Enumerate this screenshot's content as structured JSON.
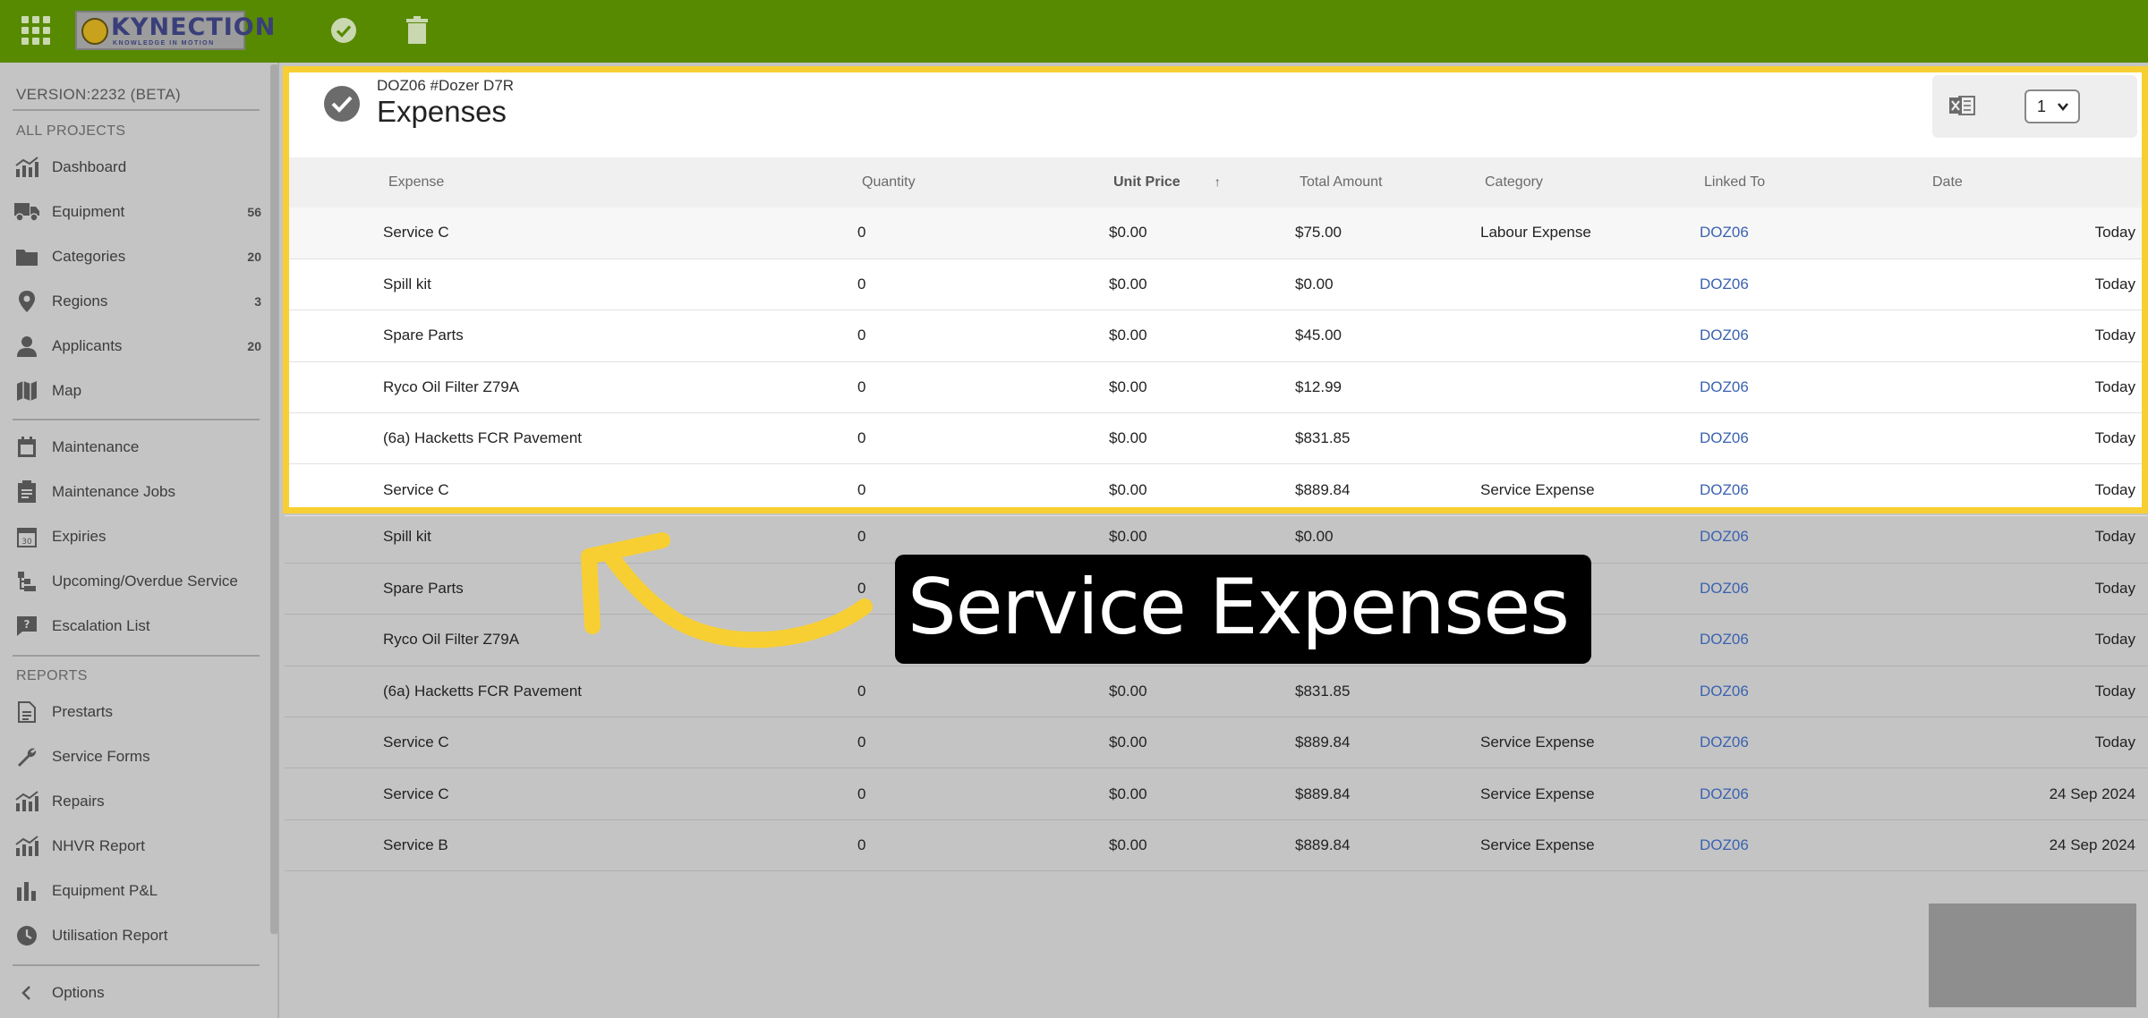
{
  "topbar": {
    "logo_text": "KYNECTION",
    "logo_tagline": "KNOWLEDGE IN MOTION"
  },
  "sidebar": {
    "version": "VERSION:2232 (BETA)",
    "section_projects": "ALL PROJECTS",
    "section_reports": "REPORTS",
    "items": [
      {
        "label": "Dashboard",
        "count": "",
        "icon": "chart-icon"
      },
      {
        "label": "Equipment",
        "count": "56",
        "icon": "truck-icon"
      },
      {
        "label": "Categories",
        "count": "20",
        "icon": "folder-icon"
      },
      {
        "label": "Regions",
        "count": "3",
        "icon": "pin-icon"
      },
      {
        "label": "Applicants",
        "count": "20",
        "icon": "person-icon"
      },
      {
        "label": "Map",
        "count": "",
        "icon": "map-icon"
      },
      {
        "label": "Maintenance",
        "count": "",
        "icon": "calendar-icon"
      },
      {
        "label": "Maintenance Jobs",
        "count": "",
        "icon": "clipboard-icon"
      },
      {
        "label": "Expiries",
        "count": "",
        "icon": "calendar-30-icon"
      },
      {
        "label": "Upcoming/Overdue Service",
        "count": "",
        "icon": "tree-icon"
      },
      {
        "label": "Escalation List",
        "count": "",
        "icon": "question-icon"
      },
      {
        "label": "Prestarts",
        "count": "",
        "icon": "document-icon"
      },
      {
        "label": "Service Forms",
        "count": "",
        "icon": "wrench-icon"
      },
      {
        "label": "Repairs",
        "count": "",
        "icon": "chart-icon"
      },
      {
        "label": "NHVR Report",
        "count": "",
        "icon": "chart-icon"
      },
      {
        "label": "Equipment P&L",
        "count": "",
        "icon": "bars-icon"
      },
      {
        "label": "Utilisation Report",
        "count": "",
        "icon": "clock-icon"
      }
    ],
    "options_label": "Options"
  },
  "header": {
    "equipment_id": "DOZ06 #Dozer D7R",
    "title": "Expenses",
    "page_select_value": "1"
  },
  "table": {
    "columns": [
      "Expense",
      "Quantity",
      "Unit Price",
      "Total Amount",
      "Category",
      "Linked To",
      "Date"
    ],
    "sort_indicator": "↑",
    "rows": [
      {
        "expense": "Service C",
        "qty": "0",
        "unit": "$0.00",
        "total": "$75.00",
        "category": "Labour Expense",
        "linked": "DOZ06",
        "date": "Today"
      },
      {
        "expense": "Spill kit",
        "qty": "0",
        "unit": "$0.00",
        "total": "$0.00",
        "category": "",
        "linked": "DOZ06",
        "date": "Today"
      },
      {
        "expense": "Spare Parts",
        "qty": "0",
        "unit": "$0.00",
        "total": "$45.00",
        "category": "",
        "linked": "DOZ06",
        "date": "Today"
      },
      {
        "expense": "Ryco Oil Filter Z79A",
        "qty": "0",
        "unit": "$0.00",
        "total": "$12.99",
        "category": "",
        "linked": "DOZ06",
        "date": "Today"
      },
      {
        "expense": "(6a) Hacketts FCR Pavement",
        "qty": "0",
        "unit": "$0.00",
        "total": "$831.85",
        "category": "",
        "linked": "DOZ06",
        "date": "Today"
      },
      {
        "expense": "Service C",
        "qty": "0",
        "unit": "$0.00",
        "total": "$889.84",
        "category": "Service Expense",
        "linked": "DOZ06",
        "date": "Today"
      },
      {
        "expense": "Spill kit",
        "qty": "0",
        "unit": "$0.00",
        "total": "$0.00",
        "category": "",
        "linked": "DOZ06",
        "date": "Today"
      },
      {
        "expense": "Spare Parts",
        "qty": "0",
        "unit": "",
        "total": "",
        "category": "",
        "linked": "DOZ06",
        "date": "Today"
      },
      {
        "expense": "Ryco Oil Filter Z79A",
        "qty": "",
        "unit": "",
        "total": "",
        "category": "",
        "linked": "DOZ06",
        "date": "Today"
      },
      {
        "expense": "(6a) Hacketts FCR Pavement",
        "qty": "0",
        "unit": "$0.00",
        "total": "$831.85",
        "category": "",
        "linked": "DOZ06",
        "date": "Today"
      },
      {
        "expense": "Service C",
        "qty": "0",
        "unit": "$0.00",
        "total": "$889.84",
        "category": "Service Expense",
        "linked": "DOZ06",
        "date": "Today"
      },
      {
        "expense": "Service C",
        "qty": "0",
        "unit": "$0.00",
        "total": "$889.84",
        "category": "Service Expense",
        "linked": "DOZ06",
        "date": "24 Sep 2024"
      },
      {
        "expense": "Service B",
        "qty": "0",
        "unit": "$0.00",
        "total": "$889.84",
        "category": "Service Expense",
        "linked": "DOZ06",
        "date": "24 Sep 2024"
      }
    ]
  },
  "callout": {
    "text": "Service Expenses"
  },
  "colors": {
    "topbar": "#578a00",
    "highlight": "#f8cf32",
    "link": "#3b62b0",
    "arrow": "#f8cf32"
  }
}
